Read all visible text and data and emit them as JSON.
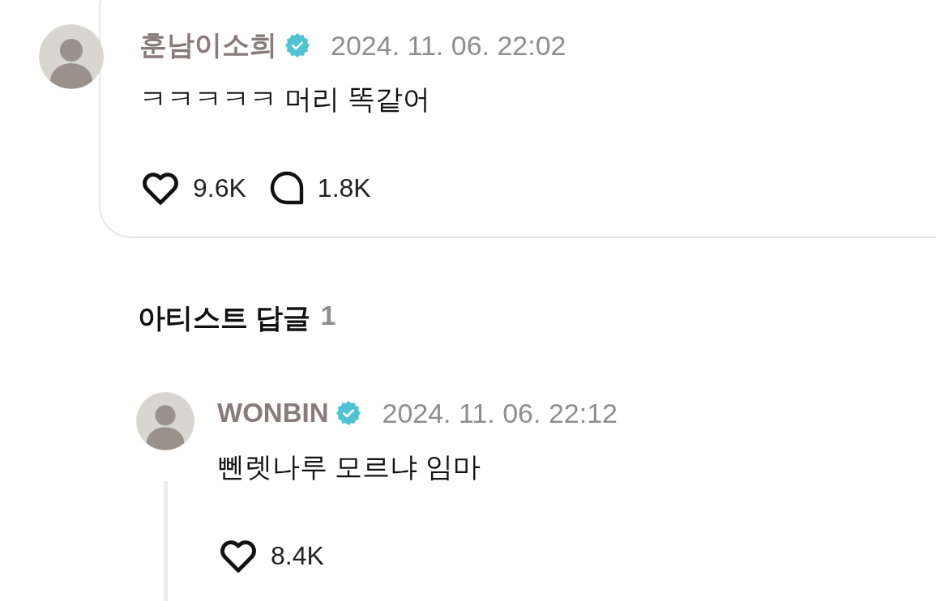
{
  "comment": {
    "author": "훈남이소희",
    "verified": true,
    "time": "2024. 11. 06. 22:02",
    "text": "ㅋㅋㅋㅋㅋ 머리 똑같어",
    "likes": "9.6K",
    "replies": "1.8K"
  },
  "artist_replies": {
    "title": "아티스트 답글",
    "count": "1",
    "items": [
      {
        "author": "WONBIN",
        "verified": true,
        "time": "2024. 11. 06. 22:12",
        "text": "뻰렛나루 모르냐 임마",
        "likes": "8.4K"
      }
    ]
  }
}
